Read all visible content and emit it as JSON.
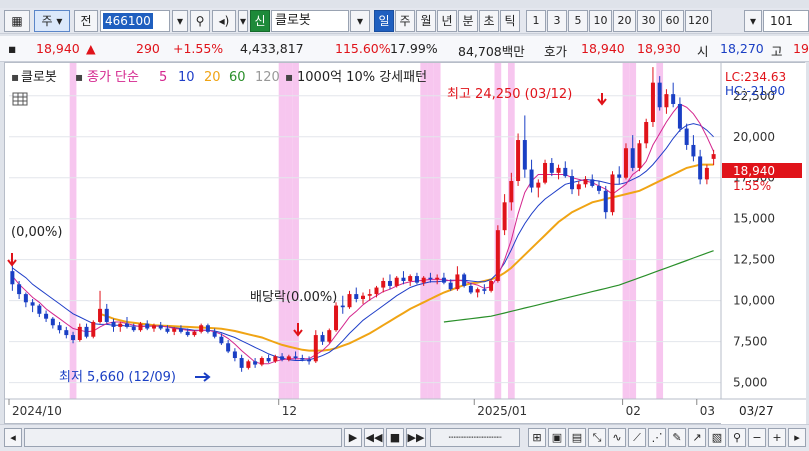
{
  "toolbar": {
    "market_label": "주",
    "jeon_label": "전",
    "stock_code": "466100",
    "sin_badge": "신",
    "stock_name": "클로봇",
    "periods": [
      "일",
      "주",
      "월",
      "년",
      "분",
      "초",
      "틱"
    ],
    "active_period": "일",
    "intervals": [
      "1",
      "3",
      "5",
      "10",
      "20",
      "30",
      "60",
      "120"
    ],
    "count_value": "101"
  },
  "quote": {
    "price": "18,940",
    "change_arrow": "▲",
    "change": "290",
    "change_pct": "+1.55%",
    "volume": "4,433,817",
    "vol_ratio": "115.60%",
    "turnover": "17.99%",
    "amount": "84,708백만",
    "hoga_label": "호가",
    "ask": "18,940",
    "bid": "18,930",
    "low_label": "시",
    "low": "18,270",
    "high_label": "고",
    "high": "19"
  },
  "legend": {
    "name": "클로봇",
    "ma_label": "종가 단순",
    "ma5": "5",
    "ma10": "10",
    "ma20": "20",
    "ma60": "60",
    "ma120": "120",
    "pattern": "1000억 10% 강세패턴"
  },
  "chart_data": {
    "type": "candlestick",
    "y_axis": {
      "ticks": [
        "22,500",
        "20,000",
        "17,500",
        "15,000",
        "12,500",
        "10,000",
        "7,500",
        "5,000"
      ],
      "ylim": [
        4000,
        24500
      ]
    },
    "x_axis": {
      "ticks": [
        "2024/10",
        "12",
        "2025/01",
        "02",
        "03"
      ],
      "date_label": "03/27"
    },
    "lc": "LC:234.63",
    "hc": "HC:-21.90",
    "last_price_tag": "18,940",
    "last_pct_tag": "1.55%",
    "annotations": {
      "high": "최고 24,250 (03/12)",
      "low": "최저 5,660 (12/09)",
      "dividend": "배당락(0.00%)",
      "left_marker": "(0,00%)"
    },
    "colors": {
      "up": "#e0131a",
      "down": "#1a3fc4",
      "ma5": "#d4268e",
      "ma10": "#1f3ec8",
      "ma20": "#f0a414",
      "ma60": "#2a8f2a",
      "highlight": "#f7c6ef"
    },
    "candles": [
      [
        11800,
        12400,
        10600,
        11000
      ],
      [
        11000,
        11200,
        10100,
        10400
      ],
      [
        10400,
        10500,
        9600,
        9900
      ],
      [
        9900,
        10100,
        9300,
        9700
      ],
      [
        9700,
        9800,
        9000,
        9200
      ],
      [
        9200,
        9400,
        8700,
        8900
      ],
      [
        8900,
        9000,
        8300,
        8500
      ],
      [
        8500,
        8700,
        8000,
        8200
      ],
      [
        8200,
        8400,
        7700,
        7900
      ],
      [
        7900,
        8100,
        7400,
        7600
      ],
      [
        7600,
        8600,
        7500,
        8400
      ],
      [
        8400,
        8600,
        7700,
        7800
      ],
      [
        7800,
        8800,
        7700,
        8700
      ],
      [
        8700,
        10600,
        8600,
        9500
      ],
      [
        9500,
        9800,
        8600,
        8700
      ],
      [
        8700,
        8900,
        8100,
        8400
      ],
      [
        8400,
        8700,
        8100,
        8600
      ],
      [
        8600,
        9000,
        8300,
        8400
      ],
      [
        8400,
        8600,
        8100,
        8200
      ],
      [
        8200,
        8700,
        8100,
        8600
      ],
      [
        8600,
        8800,
        8200,
        8300
      ],
      [
        8300,
        8600,
        8100,
        8500
      ],
      [
        8500,
        8700,
        8200,
        8300
      ],
      [
        8300,
        8500,
        8000,
        8100
      ],
      [
        8100,
        8400,
        7900,
        8300
      ],
      [
        8300,
        8500,
        8000,
        8100
      ],
      [
        8100,
        8300,
        7800,
        7900
      ],
      [
        7900,
        8200,
        7800,
        8100
      ],
      [
        8100,
        8600,
        8000,
        8500
      ],
      [
        8500,
        8600,
        8000,
        8100
      ],
      [
        8100,
        8300,
        7700,
        7800
      ],
      [
        7800,
        8000,
        7300,
        7400
      ],
      [
        7400,
        7600,
        6800,
        6900
      ],
      [
        6900,
        7100,
        6300,
        6500
      ],
      [
        6500,
        6700,
        5660,
        5900
      ],
      [
        5900,
        6400,
        5800,
        6300
      ],
      [
        6300,
        6500,
        5900,
        6100
      ],
      [
        6100,
        6600,
        6000,
        6500
      ],
      [
        6500,
        6700,
        6200,
        6300
      ],
      [
        6300,
        6700,
        6200,
        6600
      ],
      [
        6600,
        6800,
        6300,
        6400
      ],
      [
        6400,
        6700,
        6300,
        6600
      ],
      [
        6600,
        6900,
        6400,
        6500
      ],
      [
        6500,
        6700,
        6300,
        6400
      ],
      [
        6400,
        6600,
        6100,
        6300
      ],
      [
        6300,
        8200,
        6200,
        7900
      ],
      [
        7900,
        8100,
        7300,
        7500
      ],
      [
        7500,
        8300,
        7400,
        8200
      ],
      [
        8200,
        9900,
        8100,
        9700
      ],
      [
        9700,
        10300,
        9200,
        9600
      ],
      [
        9600,
        10600,
        9500,
        10400
      ],
      [
        10400,
        10800,
        9900,
        10100
      ],
      [
        10100,
        10500,
        9800,
        10300
      ],
      [
        10300,
        10700,
        10000,
        10400
      ],
      [
        10400,
        10900,
        10200,
        10800
      ],
      [
        10800,
        11400,
        10500,
        11200
      ],
      [
        11200,
        11600,
        10700,
        10900
      ],
      [
        10900,
        11500,
        10800,
        11400
      ],
      [
        11400,
        11800,
        11000,
        11200
      ],
      [
        11200,
        11600,
        10900,
        11500
      ],
      [
        11500,
        11700,
        11000,
        11100
      ],
      [
        11100,
        11500,
        10900,
        11400
      ],
      [
        11400,
        11700,
        11100,
        11300
      ],
      [
        11300,
        11600,
        11000,
        11400
      ],
      [
        11400,
        11700,
        11000,
        11100
      ],
      [
        11100,
        11300,
        10600,
        10700
      ],
      [
        10700,
        12100,
        10600,
        11600
      ],
      [
        11600,
        11700,
        10800,
        10900
      ],
      [
        10900,
        11100,
        10400,
        10500
      ],
      [
        10500,
        10800,
        10200,
        10700
      ],
      [
        10700,
        11000,
        10400,
        10600
      ],
      [
        10600,
        11300,
        10500,
        11200
      ],
      [
        11200,
        14600,
        11100,
        14300
      ],
      [
        14300,
        16500,
        14000,
        16000
      ],
      [
        16000,
        17800,
        15500,
        17300
      ],
      [
        17300,
        20200,
        17000,
        19800
      ],
      [
        19800,
        21300,
        17500,
        18000
      ],
      [
        18000,
        18600,
        16600,
        16900
      ],
      [
        16900,
        17400,
        16300,
        17200
      ],
      [
        17200,
        18600,
        17100,
        18400
      ],
      [
        18400,
        18700,
        17600,
        17800
      ],
      [
        17800,
        18300,
        17400,
        18100
      ],
      [
        18100,
        18500,
        17500,
        17600
      ],
      [
        17600,
        18000,
        16500,
        16800
      ],
      [
        16800,
        17300,
        16400,
        17100
      ],
      [
        17100,
        17600,
        16900,
        17400
      ],
      [
        17400,
        17700,
        16900,
        17000
      ],
      [
        17000,
        17300,
        16500,
        16700
      ],
      [
        16700,
        17000,
        15000,
        15400
      ],
      [
        15400,
        17900,
        15200,
        17700
      ],
      [
        17700,
        18200,
        17100,
        17500
      ],
      [
        17500,
        19600,
        17400,
        19300
      ],
      [
        19300,
        20100,
        17900,
        18100
      ],
      [
        18100,
        19800,
        17900,
        19600
      ],
      [
        19600,
        21100,
        19300,
        20900
      ],
      [
        20900,
        24250,
        20600,
        23300
      ],
      [
        23300,
        23700,
        21600,
        21800
      ],
      [
        21800,
        22900,
        21400,
        22600
      ],
      [
        22600,
        23300,
        21800,
        22000
      ],
      [
        22000,
        22400,
        20300,
        20500
      ],
      [
        20500,
        20800,
        19200,
        19500
      ],
      [
        19500,
        20100,
        18500,
        18800
      ],
      [
        18800,
        19200,
        17100,
        17400
      ],
      [
        17400,
        18300,
        17100,
        18100
      ],
      [
        18650,
        19200,
        18270,
        18940
      ]
    ],
    "ma5": [
      11500,
      11000,
      10600,
      10200,
      9900,
      9500,
      9200,
      8900,
      8600,
      8300,
      8200,
      8100,
      8150,
      8400,
      8600,
      8700,
      8700,
      8600,
      8500,
      8400,
      8450,
      8450,
      8450,
      8400,
      8300,
      8250,
      8200,
      8150,
      8200,
      8200,
      8100,
      7950,
      7700,
      7350,
      6950,
      6600,
      6250,
      6150,
      6150,
      6300,
      6400,
      6450,
      6450,
      6450,
      6450,
      6700,
      6950,
      7350,
      7900,
      8450,
      9000,
      9350,
      9750,
      10050,
      10300,
      10550,
      10700,
      10900,
      11050,
      11150,
      11200,
      11250,
      11300,
      11300,
      11300,
      11200,
      11250,
      11200,
      11050,
      10950,
      10750,
      10850,
      11500,
      12500,
      13700,
      15300,
      16600,
      17300,
      17700,
      17700,
      17700,
      17700,
      17700,
      17500,
      17400,
      17300,
      17200,
      17000,
      16800,
      16500,
      16800,
      17100,
      17700,
      18000,
      18500,
      19500,
      20200,
      20900,
      21500,
      22000,
      21800,
      21400,
      20800,
      20000,
      19100
    ],
    "ma10": [
      12000,
      11700,
      11400,
      11000,
      10700,
      10400,
      10100,
      9800,
      9500,
      9200,
      9000,
      8800,
      8600,
      8550,
      8550,
      8500,
      8500,
      8450,
      8450,
      8450,
      8450,
      8450,
      8450,
      8400,
      8350,
      8300,
      8250,
      8200,
      8200,
      8200,
      8150,
      8050,
      7900,
      7750,
      7550,
      7350,
      7150,
      6950,
      6750,
      6600,
      6500,
      6400,
      6350,
      6350,
      6400,
      6500,
      6650,
      6850,
      7150,
      7550,
      8000,
      8400,
      8800,
      9100,
      9400,
      9700,
      10000,
      10300,
      10550,
      10800,
      10950,
      11050,
      11150,
      11150,
      11200,
      11250,
      11250,
      11250,
      11200,
      11150,
      11150,
      11300,
      11700,
      12300,
      13100,
      14000,
      14700,
      15300,
      15800,
      16200,
      16500,
      16800,
      17100,
      17200,
      17300,
      17400,
      17350,
      17300,
      17200,
      17100,
      17100,
      17200,
      17400,
      17600,
      17900,
      18300,
      18800,
      19300,
      19900,
      20400,
      20700,
      20800,
      20700,
      20400,
      20000
    ],
    "ma20": [
      null,
      null,
      null,
      null,
      null,
      null,
      null,
      null,
      null,
      null,
      null,
      null,
      null,
      9200,
      9050,
      8900,
      8800,
      8700,
      8650,
      8600,
      8550,
      8500,
      8480,
      8460,
      8440,
      8420,
      8400,
      8380,
      8360,
      8340,
      8320,
      8280,
      8220,
      8150,
      8050,
      7950,
      7850,
      7750,
      7600,
      7450,
      7300,
      7200,
      7100,
      7000,
      6950,
      6950,
      6950,
      7000,
      7100,
      7250,
      7400,
      7600,
      7800,
      8000,
      8250,
      8500,
      8750,
      9000,
      9250,
      9500,
      9700,
      9900,
      10100,
      10300,
      10500,
      10650,
      10800,
      10950,
      11050,
      11100,
      11200,
      11300,
      11450,
      11700,
      12000,
      12400,
      12800,
      13200,
      13600,
      14000,
      14400,
      14800,
      15100,
      15400,
      15600,
      15800,
      16000,
      16100,
      16200,
      16300,
      16400,
      16500,
      16600,
      16700,
      16900,
      17100,
      17300,
      17500,
      17700,
      17900,
      18100,
      18200,
      18300,
      18300,
      18300
    ],
    "ma60": [
      null,
      null,
      null,
      null,
      null,
      null,
      null,
      null,
      null,
      null,
      null,
      null,
      null,
      null,
      null,
      null,
      null,
      null,
      null,
      null,
      null,
      null,
      null,
      null,
      null,
      null,
      null,
      null,
      null,
      null,
      null,
      null,
      null,
      null,
      null,
      null,
      null,
      null,
      null,
      null,
      null,
      null,
      null,
      null,
      null,
      null,
      null,
      null,
      null,
      null,
      null,
      null,
      null,
      null,
      null,
      null,
      null,
      null,
      null,
      null,
      null,
      null,
      null,
      null,
      8700,
      8750,
      8800,
      8850,
      8900,
      8950,
      9000,
      9050,
      9150,
      9250,
      9350,
      9450,
      9550,
      9650,
      9750,
      9850,
      9950,
      10050,
      10150,
      10250,
      10350,
      10450,
      10550,
      10650,
      10750,
      10850,
      10950,
      11100,
      11250,
      11400,
      11550,
      11700,
      11850,
      12000,
      12150,
      12300,
      12450,
      12600,
      12750,
      12900,
      13050
    ],
    "highlights": [
      9,
      40,
      41,
      42,
      61,
      62,
      63,
      72,
      74,
      91,
      92,
      96
    ]
  },
  "bottom": {
    "nav_buttons": [
      "▶",
      "◀◀",
      "■",
      "▶▶"
    ],
    "zoom_out": "−",
    "zoom_in": "+"
  }
}
